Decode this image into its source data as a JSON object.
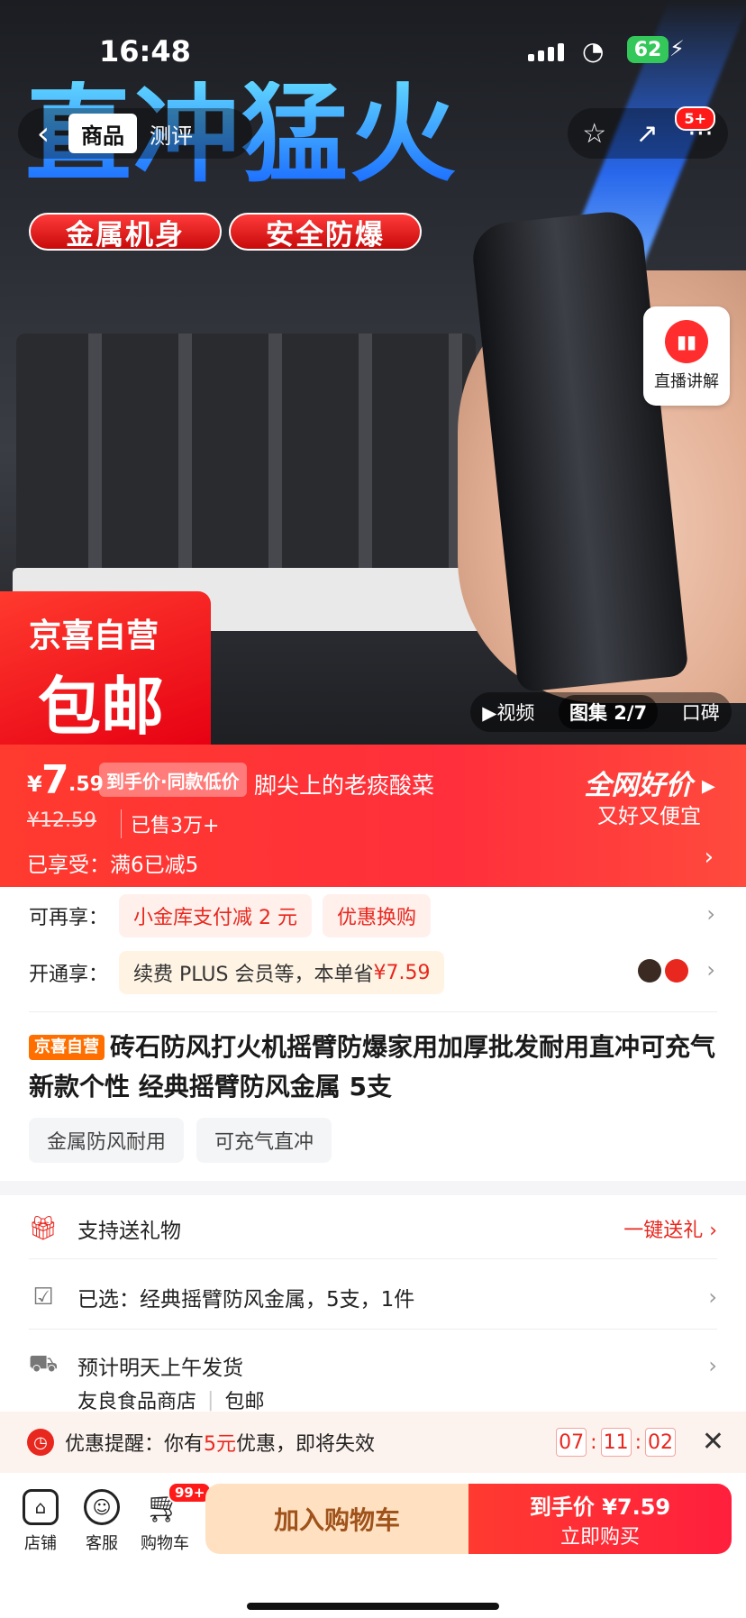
{
  "status_bar": {
    "time": "16:48",
    "battery": "62"
  },
  "nav": {
    "tabs": [
      "商品",
      "测评"
    ],
    "more_badge": "5+"
  },
  "hero": {
    "headline": "直冲猛火",
    "pill_1": "金属机身",
    "pill_2": "安全防爆",
    "promo_line1": "京喜自营",
    "promo_line2": "包邮",
    "live_label": "直播讲解",
    "gallery": {
      "video": "▶视频",
      "album": "图集 2/7",
      "reviews": "口碑"
    }
  },
  "price": {
    "currency": "¥",
    "integer": "7",
    "decimal": ".59",
    "tag": "到手价·同款低价",
    "marquee": "脚尖上的老痰酸菜",
    "original": "¥12.59",
    "sold": "已售3万+",
    "promo": "已享受：满6已减5",
    "good_title": "全网好价 ▸",
    "good_sub": "又好又便宜"
  },
  "offers": {
    "row1_label": "可再享：",
    "row1_chip1": "小金库支付减 2 元",
    "row1_chip2": "优惠换购",
    "row2_label": "开通享：",
    "row2_chip_text": "续费 PLUS 会员等，本单省 ",
    "row2_chip_amount": "¥7.59"
  },
  "product": {
    "self_badge": "京喜自营",
    "title": "砖石防风打火机摇臂防爆家用加厚批发耐用直冲可充气新款个性 经典摇臂防风金属 5支",
    "tags": [
      "金属防风耐用",
      "可充气直冲"
    ]
  },
  "info": {
    "gift": "支持送礼物",
    "gift_action": "一键送礼 ›",
    "selected": "已选：经典摇臂防风金属，5支，1件",
    "shipping": "预计明天上午发货",
    "store": "友良食品商店",
    "free_ship": "包邮"
  },
  "reminder": {
    "prefix": "优惠提醒：你有",
    "amount": "5元",
    "suffix": "优惠，即将失效",
    "hh": "07",
    "mm": "11",
    "ss": "02"
  },
  "bottom": {
    "store": "店铺",
    "service": "客服",
    "cart": "购物车",
    "cart_badge": "99+",
    "add_cart": "加入购物车",
    "buy_label": "到手价",
    "buy_price": "¥7.59",
    "buy_now": "立即购买"
  }
}
